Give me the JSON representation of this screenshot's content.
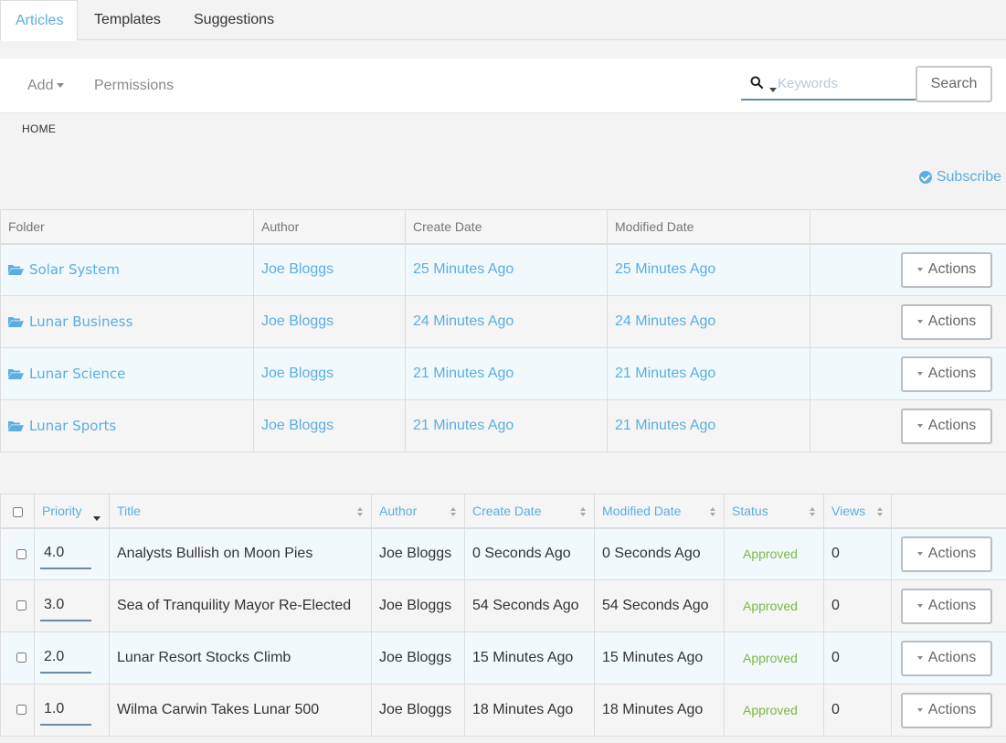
{
  "tabs": [
    {
      "label": "Articles",
      "active": true
    },
    {
      "label": "Templates",
      "active": false
    },
    {
      "label": "Suggestions",
      "active": false
    }
  ],
  "toolbar": {
    "add_label": "Add",
    "permissions_label": "Permissions",
    "search_placeholder": "Keywords",
    "search_value": "",
    "search_button": "Search"
  },
  "breadcrumb": "HOME",
  "subscribe_label": "Subscribe",
  "colors": {
    "accent": "#5aaee1",
    "approved": "#7bb844"
  },
  "folders": {
    "headers": [
      "Folder",
      "Author",
      "Create Date",
      "Modified Date",
      ""
    ],
    "rows": [
      {
        "name": "Solar System",
        "author": "Joe Bloggs",
        "created": "25 Minutes Ago",
        "modified": "25 Minutes Ago",
        "action": "Actions"
      },
      {
        "name": "Lunar Business",
        "author": "Joe Bloggs",
        "created": "24 Minutes Ago",
        "modified": "24 Minutes Ago",
        "action": "Actions"
      },
      {
        "name": "Lunar Science",
        "author": "Joe Bloggs",
        "created": "21 Minutes Ago",
        "modified": "21 Minutes Ago",
        "action": "Actions"
      },
      {
        "name": "Lunar Sports",
        "author": "Joe Bloggs",
        "created": "21 Minutes Ago",
        "modified": "21 Minutes Ago",
        "action": "Actions"
      }
    ]
  },
  "articles": {
    "headers": [
      "Priority",
      "Title",
      "Author",
      "Create Date",
      "Modified Date",
      "Status",
      "Views"
    ],
    "rows": [
      {
        "priority": "4.0",
        "title": "Analysts Bullish on Moon Pies",
        "author": "Joe Bloggs",
        "created": "0 Seconds Ago",
        "modified": "0 Seconds Ago",
        "status": "Approved",
        "views": "0",
        "action": "Actions"
      },
      {
        "priority": "3.0",
        "title": "Sea of Tranquility Mayor Re-Elected",
        "author": "Joe Bloggs",
        "created": "54 Seconds Ago",
        "modified": "54 Seconds Ago",
        "status": "Approved",
        "views": "0",
        "action": "Actions"
      },
      {
        "priority": "2.0",
        "title": "Lunar Resort Stocks Climb",
        "author": "Joe Bloggs",
        "created": "15 Minutes Ago",
        "modified": "15 Minutes Ago",
        "status": "Approved",
        "views": "0",
        "action": "Actions"
      },
      {
        "priority": "1.0",
        "title": "Wilma Carwin Takes Lunar 500",
        "author": "Joe Bloggs",
        "created": "18 Minutes Ago",
        "modified": "18 Minutes Ago",
        "status": "Approved",
        "views": "0",
        "action": "Actions"
      }
    ]
  }
}
